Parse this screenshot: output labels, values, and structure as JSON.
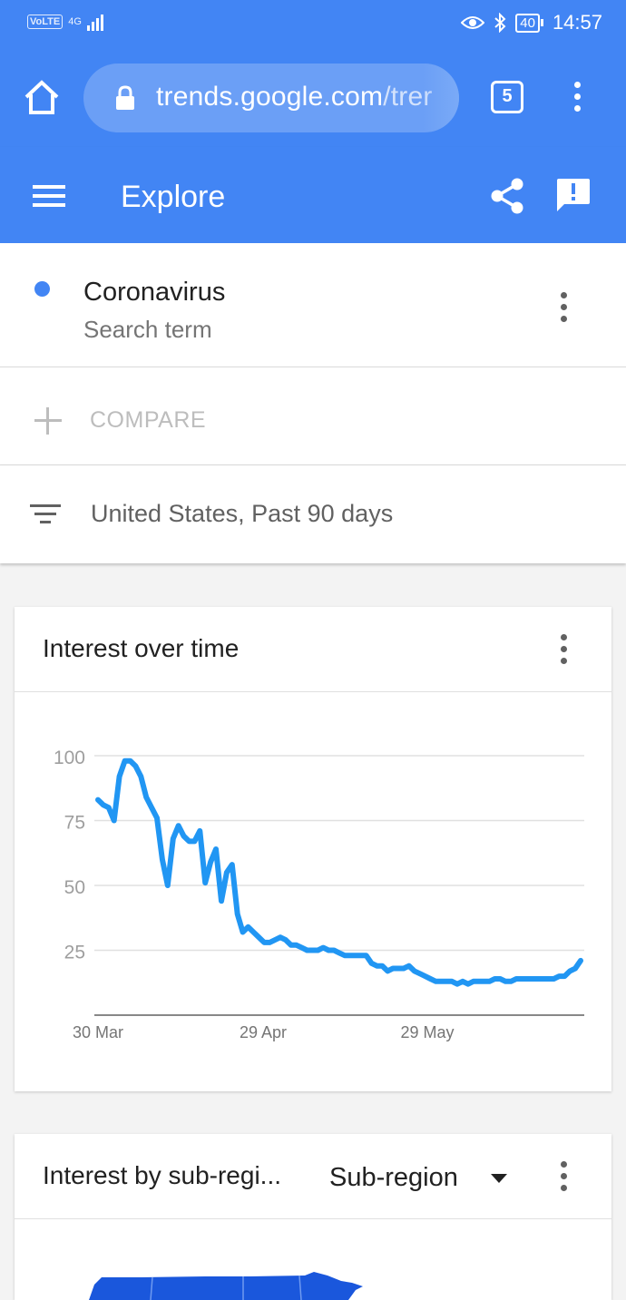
{
  "status_bar": {
    "volte": "VoLTE",
    "network": "4G",
    "battery": "40",
    "time": "14:57"
  },
  "browser": {
    "url_host": "trends.google.com",
    "url_path": "/trer",
    "tab_count": "5"
  },
  "app_bar": {
    "title": "Explore"
  },
  "search_term": {
    "name": "Coronavirus",
    "type": "Search term",
    "color": "#4285f4"
  },
  "compare": {
    "label": "COMPARE"
  },
  "filter": {
    "text": "United States, Past 90 days"
  },
  "interest_over_time": {
    "title": "Interest over time"
  },
  "sub_region": {
    "title": "Interest by sub-regi...",
    "select_value": "Sub-region"
  },
  "chart_data": {
    "type": "line",
    "title": "Interest over time",
    "xlabel": "",
    "ylabel": "",
    "yticks": [
      25,
      50,
      75,
      100
    ],
    "ylim": [
      0,
      100
    ],
    "xticks": [
      "30 Mar",
      "29 Apr",
      "29 May"
    ],
    "grid": true,
    "series": [
      {
        "color": "#2196f3",
        "values": [
          83,
          81,
          80,
          75,
          92,
          98,
          98,
          96,
          92,
          84,
          80,
          76,
          60,
          50,
          68,
          73,
          69,
          67,
          67,
          71,
          51,
          59,
          64,
          44,
          55,
          58,
          39,
          32,
          34,
          32,
          30,
          28,
          28,
          29,
          30,
          29,
          27,
          27,
          26,
          25,
          25,
          25,
          26,
          25,
          25,
          24,
          23,
          23,
          23,
          23,
          23,
          20,
          19,
          19,
          17,
          18,
          18,
          18,
          19,
          17,
          16,
          15,
          14,
          13,
          13,
          13,
          13,
          12,
          13,
          12,
          13,
          13,
          13,
          13,
          14,
          14,
          13,
          13,
          14,
          14,
          14,
          14,
          14,
          14,
          14,
          14,
          15,
          15,
          17,
          18,
          21
        ]
      }
    ]
  }
}
